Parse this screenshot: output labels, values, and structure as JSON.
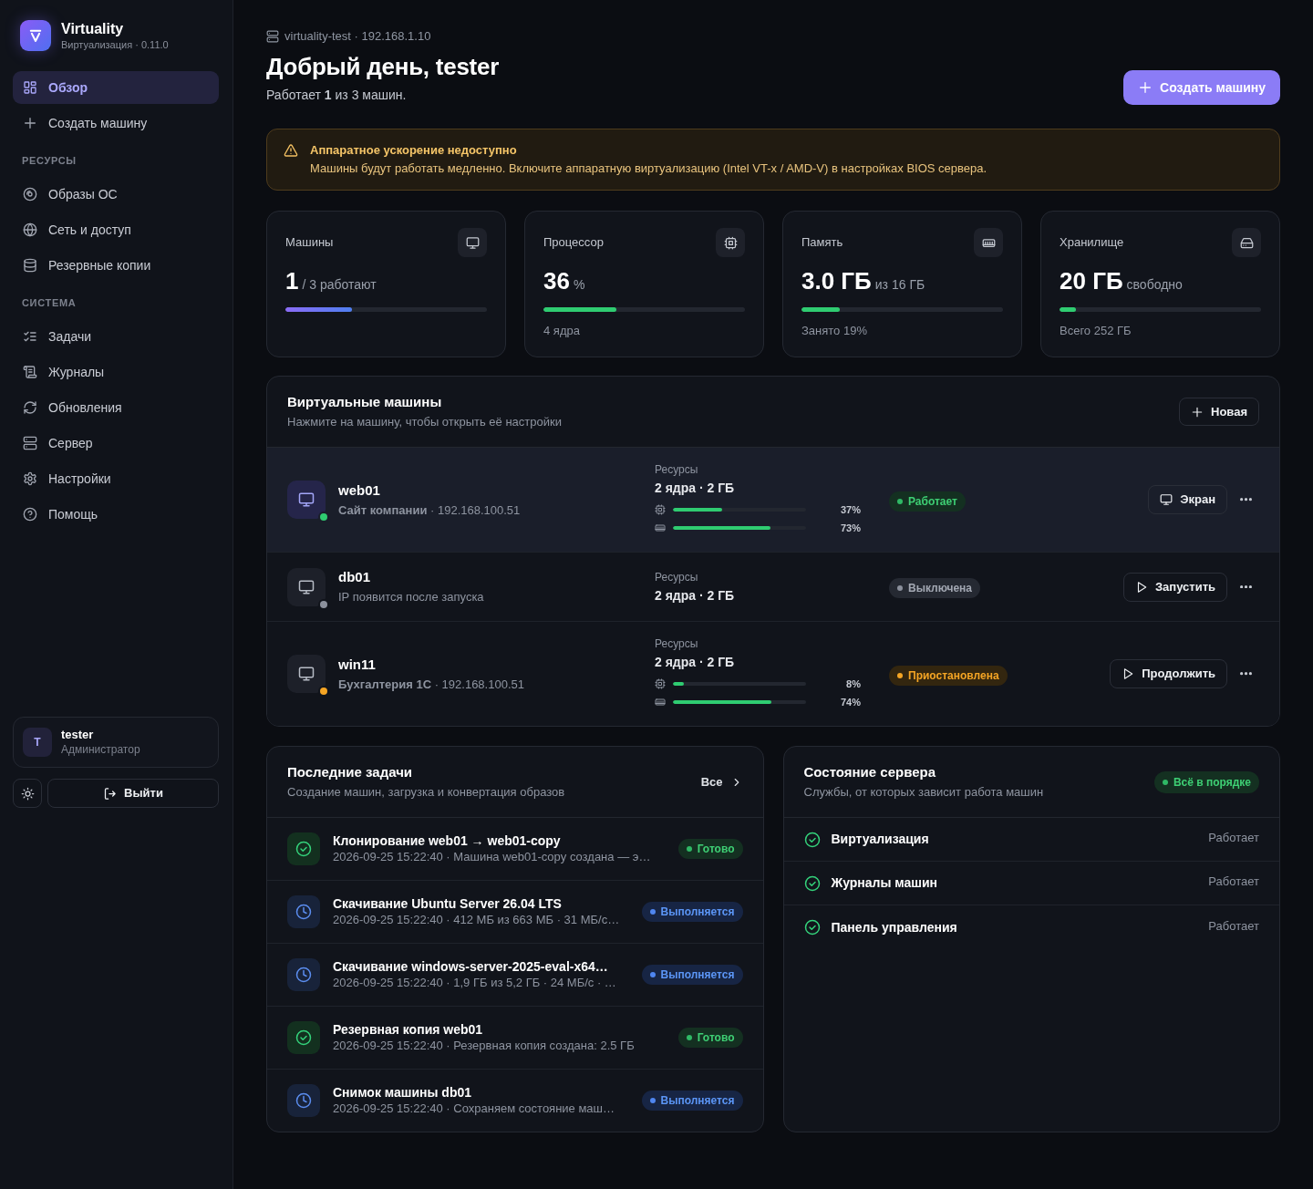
{
  "sidebar": {
    "brand": {
      "title": "Virtuality",
      "subtitle": "Виртуализация · 0.11.0"
    },
    "groups": [
      {
        "items": [
          {
            "label": "Обзор",
            "selected": true
          },
          {
            "label": "Создать машину",
            "selected": false
          }
        ]
      },
      {
        "heading": "РЕСУРСЫ",
        "items": [
          {
            "label": "Образы ОС",
            "selected": false
          },
          {
            "label": "Сеть и доступ",
            "selected": false
          },
          {
            "label": "Резервные копии",
            "selected": false
          }
        ]
      },
      {
        "heading": "СИСТЕМА",
        "items": [
          {
            "label": "Задачи",
            "selected": false
          },
          {
            "label": "Журналы",
            "selected": false
          },
          {
            "label": "Обновления",
            "selected": false
          },
          {
            "label": "Сервер",
            "selected": false
          },
          {
            "label": "Настройки",
            "selected": false
          },
          {
            "label": "Помощь",
            "selected": false
          }
        ]
      }
    ],
    "user": {
      "initial": "T",
      "name": "tester",
      "role": "Администратор"
    },
    "logout": "Выйти"
  },
  "header": {
    "server": "virtuality-test · 192.168.1.10",
    "title": "Добрый день, tester",
    "summary": "Работает **1** из 3 машин.",
    "create_button": "Создать машину"
  },
  "alert": {
    "title": "Аппаратное ускорение недоступно",
    "text": "Машины будут работать медленно. Включите аппаратную виртуализацию (Intel VT-x / AMD-V) в настройках BIOS сервера."
  },
  "stats": [
    {
      "kind": "count",
      "label": "Машины",
      "value": "1",
      "unit": "/ 3 работают",
      "level": 0.33
    },
    {
      "kind": "usage",
      "label": "Процессор",
      "value": "36",
      "unit": "%",
      "level": 0.36,
      "note": "4 ядра"
    },
    {
      "kind": "usage",
      "label": "Память",
      "value": "3.0 ГБ",
      "unit": "из 16 ГБ",
      "level": 0.19,
      "note": "Занято 19%"
    },
    {
      "kind": "usage",
      "label": "Хранилище",
      "value": "20 ГБ",
      "unit": "свободно",
      "level": 0.08,
      "note": "Всего 252 ГБ"
    }
  ],
  "vms": {
    "title": "Виртуальные машины",
    "subtitle": "Нажмите на машину, чтобы открыть её настройки",
    "new_button": "Новая",
    "rows": [
      {
        "name": "web01",
        "subtitle": "**Сайт компании** · 192.168.100.51",
        "selected": true,
        "resources_label": "Ресурсы",
        "resources": "2 ядра · 2 ГБ",
        "cpu": {
          "level": 0.37,
          "reading": "37%"
        },
        "memory": {
          "level": 0.73,
          "reading": "73%"
        },
        "status": {
          "kind": "running",
          "label": "Работает"
        },
        "action": {
          "kind": "screen",
          "label": "Экран"
        }
      },
      {
        "name": "db01",
        "subtitle": "IP появится после запуска",
        "selected": false,
        "resources_label": "Ресурсы",
        "resources": "2 ядра · 2 ГБ",
        "status": {
          "kind": "stopped",
          "label": "Выключена"
        },
        "action": {
          "kind": "start",
          "label": "Запустить"
        }
      },
      {
        "name": "win11",
        "subtitle": "**Бухгалтерия 1С** · 192.168.100.51",
        "selected": false,
        "resources_label": "Ресурсы",
        "resources": "2 ядра · 2 ГБ",
        "cpu": {
          "level": 0.08,
          "reading": "8%"
        },
        "memory": {
          "level": 0.74,
          "reading": "74%"
        },
        "status": {
          "kind": "paused",
          "label": "Приостановлена"
        },
        "action": {
          "kind": "start",
          "label": "Продолжить"
        }
      }
    ]
  },
  "tasks": {
    "title": "Последние задачи",
    "subtitle": "Создание машин, загрузка и конвертация образов",
    "link": "Все",
    "rows": [
      {
        "title": "Клонирование web01 → web01-copy",
        "detail": "2026-09-25 15:22:40 · Машина web01-copy создана — э…",
        "status": {
          "kind": "done",
          "label": "Готово"
        }
      },
      {
        "title": "Скачивание Ubuntu Server 26.04 LTS",
        "detail": "2026-09-25 15:22:40 · 412 МБ из 663 МБ · 31 МБ/с…",
        "status": {
          "kind": "running",
          "label": "Выполняется"
        }
      },
      {
        "title": "Скачивание windows-server-2025-eval-x64…",
        "detail": "2026-09-25 15:22:40 · 1,9 ГБ из 5,2 ГБ · 24 МБ/с · …",
        "status": {
          "kind": "running",
          "label": "Выполняется"
        }
      },
      {
        "title": "Резервная копия web01",
        "detail": "2026-09-25 15:22:40 · Резервная копия создана: 2.5 ГБ",
        "status": {
          "kind": "done",
          "label": "Готово"
        }
      },
      {
        "title": "Снимок машины db01",
        "detail": "2026-09-25 15:22:40 · Сохраняем состояние маш…",
        "status": {
          "kind": "running",
          "label": "Выполняется"
        }
      }
    ]
  },
  "server": {
    "title": "Состояние сервера",
    "subtitle": "Службы, от которых зависит работа машин",
    "badge": {
      "kind": "ok",
      "label": "Всё в порядке"
    },
    "services": [
      {
        "name": "Виртуализация",
        "state": "Работает",
        "ok": true
      },
      {
        "name": "Журналы машин",
        "state": "Работает",
        "ok": true
      },
      {
        "name": "Панель управления",
        "state": "Работает",
        "ok": true
      }
    ]
  }
}
